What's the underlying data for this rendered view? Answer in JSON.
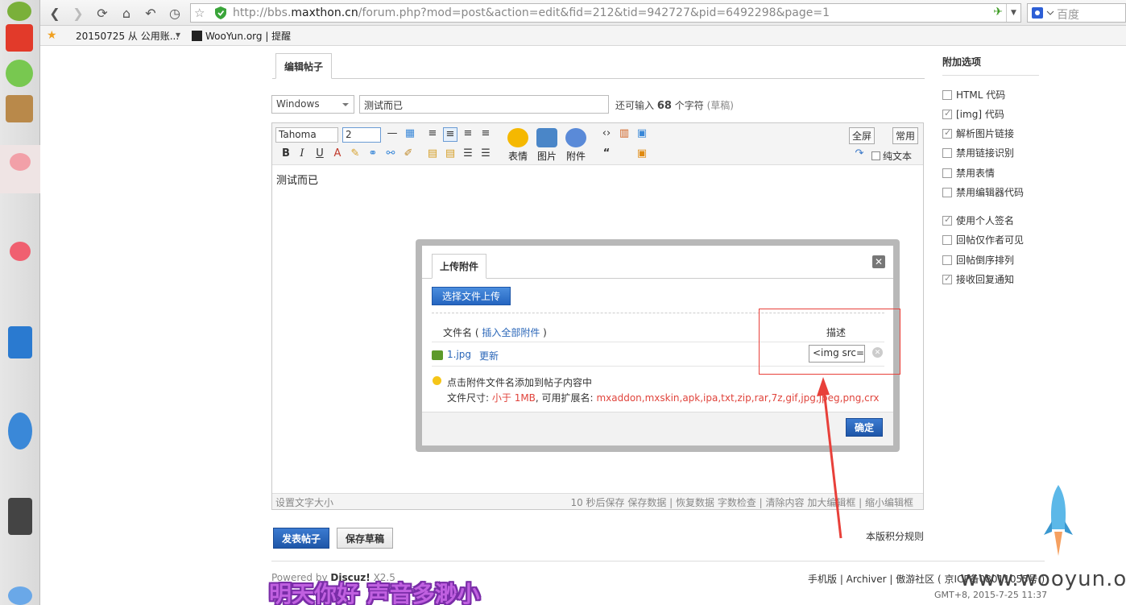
{
  "browser": {
    "url_prefix": "http://bbs.",
    "url_domain": "maxthon.cn",
    "url_path": "/forum.php?mod=post&action=edit&fid=212&tid=942727&pid=6492298&page=1",
    "search_placeholder": "百度",
    "bookmarks": [
      "20150725 从 公用账...",
      "WooYun.org | 提醒"
    ]
  },
  "post": {
    "tab_label": "编辑帖子",
    "type_select": "Windows",
    "subject_value": "测试而已",
    "chars_prefix": "还可输入",
    "chars_count": "68",
    "chars_suffix": "个字符",
    "chars_draft": "(草稿)",
    "content": "测试而已"
  },
  "editor": {
    "font": "Tahoma",
    "size": "2",
    "big_buttons": [
      "表情",
      "图片",
      "附件"
    ],
    "fullscreen": "全屏",
    "common": "常用",
    "plain_text": "纯文本",
    "status_left": "设置文字大小",
    "status_right": "10 秒后保存  保存数据 | 恢复数据     字数检查 | 清除内容     加大编辑框 | 缩小编辑框"
  },
  "actions": {
    "post_button": "发表帖子",
    "draft_button": "保存草稿",
    "rules_link": "本版积分规则"
  },
  "options": {
    "title": "附加选项",
    "items": [
      {
        "label": "HTML 代码",
        "checked": false
      },
      {
        "label": "[img] 代码",
        "checked": true
      },
      {
        "label": "解析图片链接",
        "checked": true
      },
      {
        "label": "禁用链接识别",
        "checked": false
      },
      {
        "label": "禁用表情",
        "checked": false
      },
      {
        "label": "禁用编辑器代码",
        "checked": false
      },
      {
        "label": "使用个人签名",
        "checked": true
      },
      {
        "label": "回帖仅作者可见",
        "checked": false
      },
      {
        "label": "回帖倒序排列",
        "checked": false
      },
      {
        "label": "接收回复通知",
        "checked": true
      }
    ]
  },
  "dialog": {
    "tab_label": "上传附件",
    "choose_button": "选择文件上传",
    "col_filename": "文件名",
    "insert_all": "插入全部附件",
    "col_desc": "描述",
    "file_name": "1.jpg",
    "file_update": "更新",
    "desc_value": "<img src=\"",
    "tip1": "点击附件文件名添加到帖子内容中",
    "tip2_prefix": "文件尺寸:",
    "tip2_size": "小于 1MB",
    "tip2_mid": ", 可用扩展名:",
    "tip2_exts": "mxaddon,mxskin,apk,ipa,txt,zip,rar,7z,gif,jpg,jpeg,png,crx",
    "ok_button": "确定",
    "close_icon": "✕"
  },
  "footer": {
    "powered_prefix": "Powered by",
    "powered_brand": "Discuz!",
    "powered_version": "X2.5",
    "links": "手机版 | Archiver | 傲游社区 ( 京ICP备08011055号 )",
    "time": "GMT+8, 2015-7-25 11:37"
  },
  "overlay": {
    "watermark": "www.wooyun.org",
    "subtitle_a": "明天你好",
    "subtitle_b": "声音多渺小"
  },
  "colors": {
    "accent_blue": "#2565c0",
    "link_blue": "#2a66b8",
    "highlight_red": "#e8403a"
  }
}
